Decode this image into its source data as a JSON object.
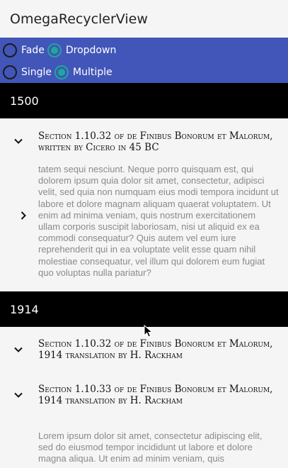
{
  "app": {
    "title": "OmegaRecyclerView"
  },
  "options": {
    "row1": [
      {
        "label": "Fade",
        "selected": false
      },
      {
        "label": "Dropdown",
        "selected": true
      }
    ],
    "row2": [
      {
        "label": "Single",
        "selected": false
      },
      {
        "label": "Multiple",
        "selected": true
      }
    ]
  },
  "sections": [
    {
      "header": "1500",
      "items": [
        {
          "title": "Section 1.10.32 of de Finibus Bonorum et Malorum, written by Cicero in 45 BC",
          "body": "tatem sequi nesciunt. Neque porro quisquam est, qui dolorem ipsum quia dolor sit amet, consectetur, adipisci velit, sed quia non numquam eius modi tempora incidunt ut labore et dolore magnam aliquam quaerat voluptatem. Ut enim ad minima veniam, quis nostrum exercitationem ullam corporis suscipit laboriosam, nisi ut aliquid ex ea commodi consequatur? Quis autem vel eum iure reprehenderit qui in ea voluptate velit esse quam nihil molestiae consequatur, vel illum qui dolorem eum fugiat quo voluptas nulla pariatur?"
        }
      ]
    },
    {
      "header": "1914",
      "items": [
        {
          "title": "Section 1.10.32 of de Finibus Bonorum et Malorum, 1914 translation by H. Rackham"
        },
        {
          "title": "Section 1.10.33 of de Finibus Bonorum et Malorum, 1914 translation by H. Rackham",
          "body": "Lorem ipsum dolor sit amet, consectetur adipiscing elit, sed do eiusmod tempor incididunt ut labore et dolore magna aliqua. Ut enim ad minim veniam, quis"
        }
      ]
    }
  ],
  "icons": {
    "expanded": "chevron-down-icon",
    "collapsed": "chevron-right-icon",
    "cursor": "mouse-pointer-icon"
  }
}
